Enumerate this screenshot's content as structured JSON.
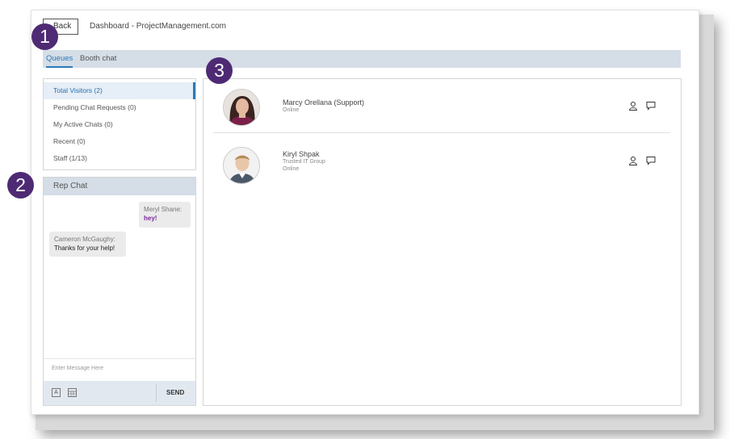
{
  "header": {
    "back_label": "Back",
    "title": "Dashboard - ProjectManagement.com"
  },
  "tabs": [
    {
      "label": "Queues",
      "active": true
    },
    {
      "label": "Booth chat",
      "active": false
    }
  ],
  "queues": [
    {
      "label": "Total Visitors (2)",
      "active": true
    },
    {
      "label": "Pending Chat Requests (0)",
      "active": false
    },
    {
      "label": "My Active Chats (0)",
      "active": false
    },
    {
      "label": "Recent (0)",
      "active": false
    },
    {
      "label": "Staff (1/13)",
      "active": false
    }
  ],
  "rep_chat": {
    "title": "Rep Chat",
    "messages": [
      {
        "sender": "Meryl Shane:",
        "text": "hey!"
      },
      {
        "sender": "Cameron McGaughy:",
        "text": "Thanks for your help!"
      }
    ],
    "input_placeholder": "Enter Message Here",
    "send_label": "SEND",
    "tool_icons": [
      "text-format-icon",
      "calendar-icon"
    ]
  },
  "visitors": [
    {
      "name": "Marcy Orellana (Support)",
      "group": "",
      "status": "Online"
    },
    {
      "name": "Kiryl Shpak",
      "group": "Trusted IT Group",
      "status": "Online"
    }
  ],
  "badges": [
    "1",
    "2",
    "3"
  ],
  "colors": {
    "accent": "#2a7ab8",
    "badge": "#4e2a74",
    "tabbar": "#d5dde6",
    "message_highlight": "#7a2a9a"
  }
}
